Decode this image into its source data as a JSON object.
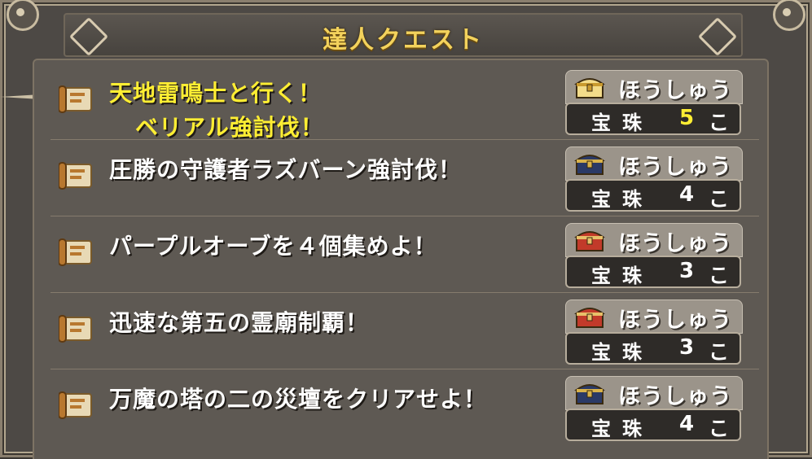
{
  "title": "達人クエスト",
  "quests": [
    {
      "line1": "天地雷鳴士と行く！",
      "line2": "ベリアル強討伐！",
      "highlight": true,
      "reward_label": "ほうしゅう",
      "item": "宝珠",
      "quantity": "5",
      "unit": "こ",
      "chest_icon": "gold-chest-icon"
    },
    {
      "line1": "圧勝の守護者ラズバーン強討伐！",
      "line2": "",
      "highlight": false,
      "reward_label": "ほうしゅう",
      "item": "宝珠",
      "quantity": "4",
      "unit": "こ",
      "chest_icon": "blue-chest-icon"
    },
    {
      "line1": "パープルオーブを４個集めよ！",
      "line2": "",
      "highlight": false,
      "reward_label": "ほうしゅう",
      "item": "宝珠",
      "quantity": "3",
      "unit": "こ",
      "chest_icon": "red-chest-icon"
    },
    {
      "line1": "迅速な第五の霊廟制覇！",
      "line2": "",
      "highlight": false,
      "reward_label": "ほうしゅう",
      "item": "宝珠",
      "quantity": "3",
      "unit": "こ",
      "chest_icon": "red-chest-icon"
    },
    {
      "line1": "万魔の塔の二の災壇をクリアせよ！",
      "line2": "",
      "highlight": false,
      "reward_label": "ほうしゅう",
      "item": "宝珠",
      "quantity": "4",
      "unit": "こ",
      "chest_icon": "blue-chest-icon"
    }
  ],
  "colors": {
    "highlight_text": "#ffee33",
    "title_text": "#f3d25c",
    "panel_bg": "#5e5953"
  }
}
